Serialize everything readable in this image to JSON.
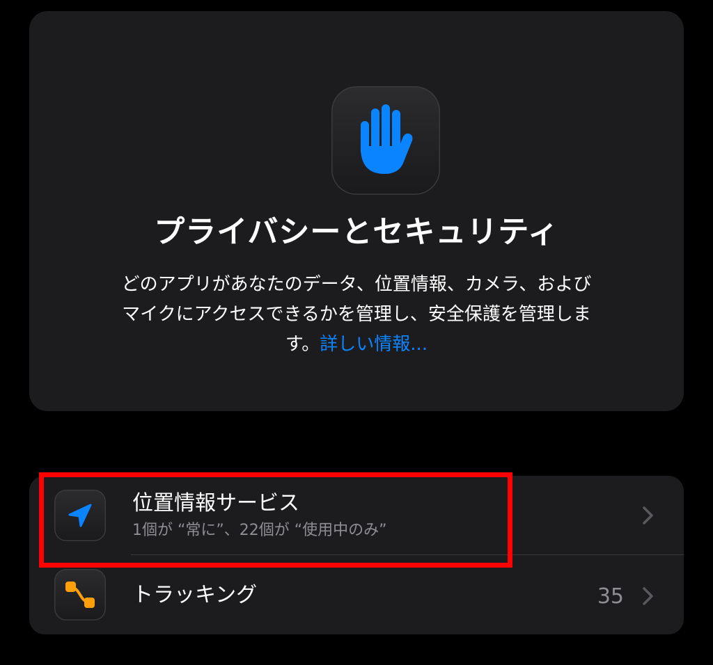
{
  "header": {
    "icon": "hand-raised-icon",
    "title": "プライバシーとセキュリティ",
    "description_line1": "どのアプリがあなたのデータ、位置情報、カメラ、および",
    "description_line2": "マイクにアクセスできるかを管理し、安全保護を管理しま",
    "description_line3": "す。",
    "learn_more": "詳しい情報..."
  },
  "settings": [
    {
      "icon": "location-arrow-icon",
      "title": "位置情報サービス",
      "subtitle": "1個が “常に”、22個が “使用中のみ”",
      "value": "",
      "chevron": "chevron-right-icon"
    },
    {
      "icon": "tracking-icon",
      "title": "トラッキング",
      "subtitle": "",
      "value": "35",
      "chevron": "chevron-right-icon"
    }
  ],
  "colors": {
    "background": "#000000",
    "card": "#1c1c1e",
    "accent_blue": "#0a84ff",
    "tracking_orange": "#ff9f0a",
    "secondary_text": "#8e8e93",
    "highlight": "#ff0000"
  }
}
